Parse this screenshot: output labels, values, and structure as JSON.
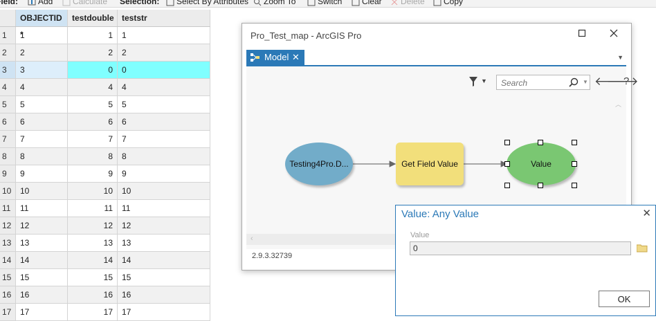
{
  "toolbar": {
    "items": {
      "field_label": "Field:",
      "add_label": "Add",
      "calculate_label": "Calculate",
      "selection_label": "Selection:",
      "select_by_attr_label": "Select By Attributes",
      "zoom_to_label": "Zoom To",
      "switch_label": "Switch",
      "clear_label": "Clear",
      "delete_label": "Delete",
      "copy_label": "Copy"
    }
  },
  "table": {
    "columns": {
      "objectid": "OBJECTID *",
      "testdouble": "testdouble",
      "teststr": "teststr"
    },
    "selected_row_index": 2,
    "selection_color": "#80ffff",
    "rows": [
      {
        "num": "1",
        "objectid": "1",
        "testdouble": "1",
        "teststr": "1"
      },
      {
        "num": "2",
        "objectid": "2",
        "testdouble": "2",
        "teststr": "2"
      },
      {
        "num": "3",
        "objectid": "3",
        "testdouble": "0",
        "teststr": "0"
      },
      {
        "num": "4",
        "objectid": "4",
        "testdouble": "4",
        "teststr": "4"
      },
      {
        "num": "5",
        "objectid": "5",
        "testdouble": "5",
        "teststr": "5"
      },
      {
        "num": "6",
        "objectid": "6",
        "testdouble": "6",
        "teststr": "6"
      },
      {
        "num": "7",
        "objectid": "7",
        "testdouble": "7",
        "teststr": "7"
      },
      {
        "num": "8",
        "objectid": "8",
        "testdouble": "8",
        "teststr": "8"
      },
      {
        "num": "9",
        "objectid": "9",
        "testdouble": "9",
        "teststr": "9"
      },
      {
        "num": "10",
        "objectid": "10",
        "testdouble": "10",
        "teststr": "10"
      },
      {
        "num": "11",
        "objectid": "11",
        "testdouble": "11",
        "teststr": "11"
      },
      {
        "num": "12",
        "objectid": "12",
        "testdouble": "12",
        "teststr": "12"
      },
      {
        "num": "13",
        "objectid": "13",
        "testdouble": "13",
        "teststr": "13"
      },
      {
        "num": "14",
        "objectid": "14",
        "testdouble": "14",
        "teststr": "14"
      },
      {
        "num": "15",
        "objectid": "15",
        "testdouble": "15",
        "teststr": "15"
      },
      {
        "num": "16",
        "objectid": "16",
        "testdouble": "16",
        "teststr": "16"
      },
      {
        "num": "17",
        "objectid": "17",
        "testdouble": "17",
        "teststr": "17"
      }
    ]
  },
  "window": {
    "title": "Pro_Test_map - ArcGIS Pro",
    "tab_label": "Model",
    "search_placeholder": "Search",
    "help_label": "?",
    "version": "2.9.3.32739",
    "accent_color": "#2b79b7"
  },
  "model": {
    "nodes": {
      "input": {
        "label": "Testing4Pro.D...",
        "color": "#72acc9"
      },
      "tool": {
        "label": "Get Field Value",
        "color": "#f2df7b"
      },
      "output": {
        "label": "Value",
        "color": "#7ac772"
      }
    }
  },
  "popup": {
    "title": "Value: Any Value",
    "field_label": "Value",
    "field_value": "0",
    "ok_label": "OK"
  }
}
